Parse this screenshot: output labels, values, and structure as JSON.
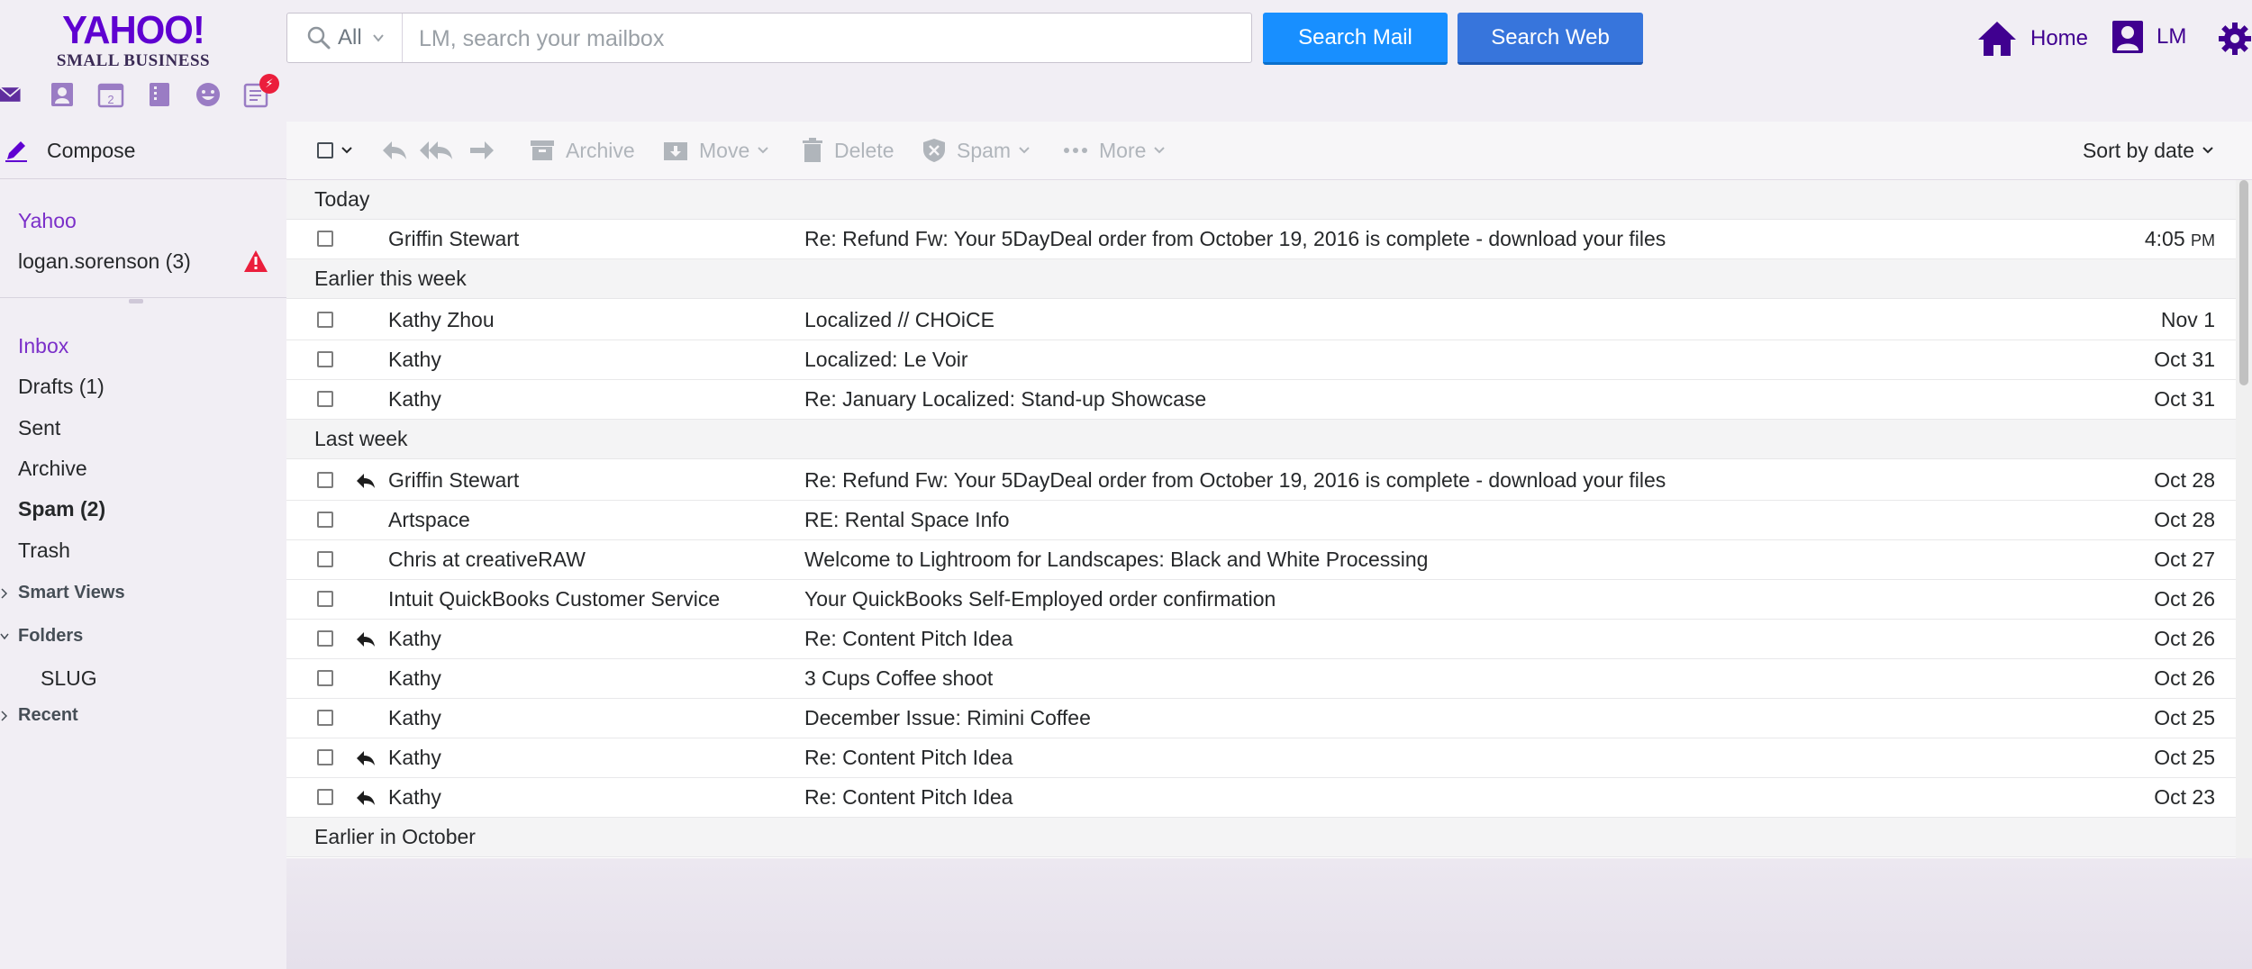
{
  "brand": {
    "logo_main": "YAHOO!",
    "logo_sub": "SMALL BUSINESS",
    "color": "#5f01d1"
  },
  "search": {
    "scope_label": "All",
    "placeholder": "LM, search your mailbox",
    "search_mail_label": "Search Mail",
    "search_web_label": "Search Web"
  },
  "topnav": {
    "home_label": "Home",
    "user_label": "LM"
  },
  "apps": {
    "items": [
      "mail-icon",
      "contacts-icon",
      "calendar-icon",
      "notepad-icon",
      "messenger-icon",
      "newsfeed-icon"
    ],
    "newsfeed_badge": "⚡"
  },
  "sidebar": {
    "compose_label": "Compose",
    "accounts": [
      {
        "label": "Yahoo"
      },
      {
        "label": "logan.sorenson  (3)"
      }
    ],
    "folders": [
      {
        "label": "Inbox"
      },
      {
        "label": "Drafts (1)"
      },
      {
        "label": "Sent"
      },
      {
        "label": "Archive"
      },
      {
        "label": "Spam (2)"
      },
      {
        "label": "Trash"
      }
    ],
    "sections": [
      {
        "label": "Smart Views"
      },
      {
        "label": "Folders"
      },
      {
        "label": "Recent"
      }
    ],
    "subfolders": [
      {
        "label": "SLUG"
      }
    ]
  },
  "toolbar": {
    "archive_label": "Archive",
    "move_label": "Move",
    "delete_label": "Delete",
    "spam_label": "Spam",
    "more_label": "More",
    "sort_label": "Sort by date"
  },
  "messages": {
    "groups": [
      {
        "label": "Today"
      },
      {
        "label": "Earlier this week"
      },
      {
        "label": "Last week"
      },
      {
        "label": "Earlier in October"
      }
    ],
    "rows": [
      {
        "from": "Griffin Stewart",
        "subject": "Re: Refund Fw: Your 5DayDeal order from October 19, 2016 is complete - download your files",
        "date": "4:05",
        "date_suffix": "PM",
        "replied": false
      },
      {
        "from": "Kathy Zhou",
        "subject": "Localized // CHOiCE",
        "date": "Nov 1",
        "date_suffix": "",
        "replied": false
      },
      {
        "from": "Kathy",
        "subject": "Localized: Le Voir",
        "date": "Oct 31",
        "date_suffix": "",
        "replied": false
      },
      {
        "from": "Kathy",
        "subject": "Re: January Localized: Stand-up Showcase",
        "date": "Oct 31",
        "date_suffix": "",
        "replied": false
      },
      {
        "from": "Griffin Stewart",
        "subject": "Re: Refund Fw: Your 5DayDeal order from October 19, 2016 is complete - download your files",
        "date": "Oct 28",
        "date_suffix": "",
        "replied": true
      },
      {
        "from": "Artspace",
        "subject": "RE: Rental Space Info",
        "date": "Oct 28",
        "date_suffix": "",
        "replied": false
      },
      {
        "from": "Chris at creativeRAW",
        "subject": "Welcome to Lightroom for Landscapes: Black and White Processing",
        "date": "Oct 27",
        "date_suffix": "",
        "replied": false
      },
      {
        "from": "Intuit QuickBooks Customer Service",
        "subject": "Your QuickBooks Self-Employed order confirmation",
        "date": "Oct 26",
        "date_suffix": "",
        "replied": false
      },
      {
        "from": "Kathy",
        "subject": "Re: Content Pitch Idea",
        "date": "Oct 26",
        "date_suffix": "",
        "replied": true
      },
      {
        "from": "Kathy",
        "subject": "3 Cups Coffee shoot",
        "date": "Oct 26",
        "date_suffix": "",
        "replied": false
      },
      {
        "from": "Kathy",
        "subject": "December Issue: Rimini Coffee",
        "date": "Oct 25",
        "date_suffix": "",
        "replied": false
      },
      {
        "from": "Kathy",
        "subject": "Re: Content Pitch Idea",
        "date": "Oct 25",
        "date_suffix": "",
        "replied": true
      },
      {
        "from": "Kathy",
        "subject": "Re: Content Pitch Idea",
        "date": "Oct 23",
        "date_suffix": "",
        "replied": true
      }
    ]
  },
  "colors": {
    "accent": "#7b2fc9",
    "search_mail": "#188fff",
    "search_web": "#3775dc",
    "alert": "#eb1e3c"
  }
}
